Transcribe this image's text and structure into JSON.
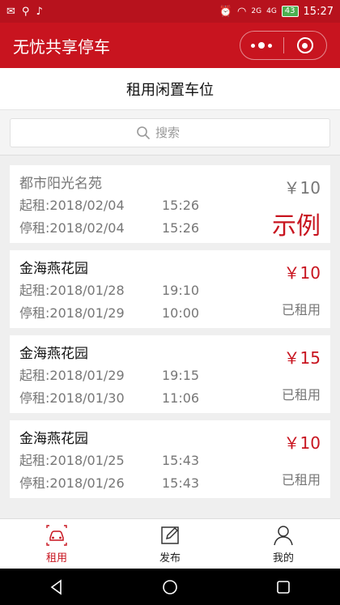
{
  "status_bar": {
    "time": "15:27",
    "battery": "43",
    "net_a": "2G",
    "net_b": "4G"
  },
  "app": {
    "title": "无忧共享停车"
  },
  "page": {
    "title": "租用闲置车位"
  },
  "search": {
    "placeholder": "搜索"
  },
  "labels": {
    "start_prefix": "起租:",
    "stop_prefix": "停租:"
  },
  "listings": [
    {
      "name": "都市阳光名苑",
      "start_date": "2018/02/04",
      "start_time": "15:26",
      "stop_date": "2018/02/04",
      "stop_time": "15:26",
      "price": "￥10",
      "status": "",
      "sample_label": "示例"
    },
    {
      "name": "金海燕花园",
      "start_date": "2018/01/28",
      "start_time": "19:10",
      "stop_date": "2018/01/29",
      "stop_time": "10:00",
      "price": "￥10",
      "status": "已租用"
    },
    {
      "name": "金海燕花园",
      "start_date": "2018/01/29",
      "start_time": "19:15",
      "stop_date": "2018/01/30",
      "stop_time": "11:06",
      "price": "￥15",
      "status": "已租用"
    },
    {
      "name": "金海燕花园",
      "start_date": "2018/01/25",
      "start_time": "15:43",
      "stop_date": "2018/01/26",
      "stop_time": "15:43",
      "price": "￥10",
      "status": "已租用"
    }
  ],
  "tabs": [
    {
      "label": "租用",
      "icon": "car-icon"
    },
    {
      "label": "发布",
      "icon": "edit-icon"
    },
    {
      "label": "我的",
      "icon": "user-icon"
    }
  ],
  "colors": {
    "brand": "#c8141f",
    "muted": "#777777"
  }
}
